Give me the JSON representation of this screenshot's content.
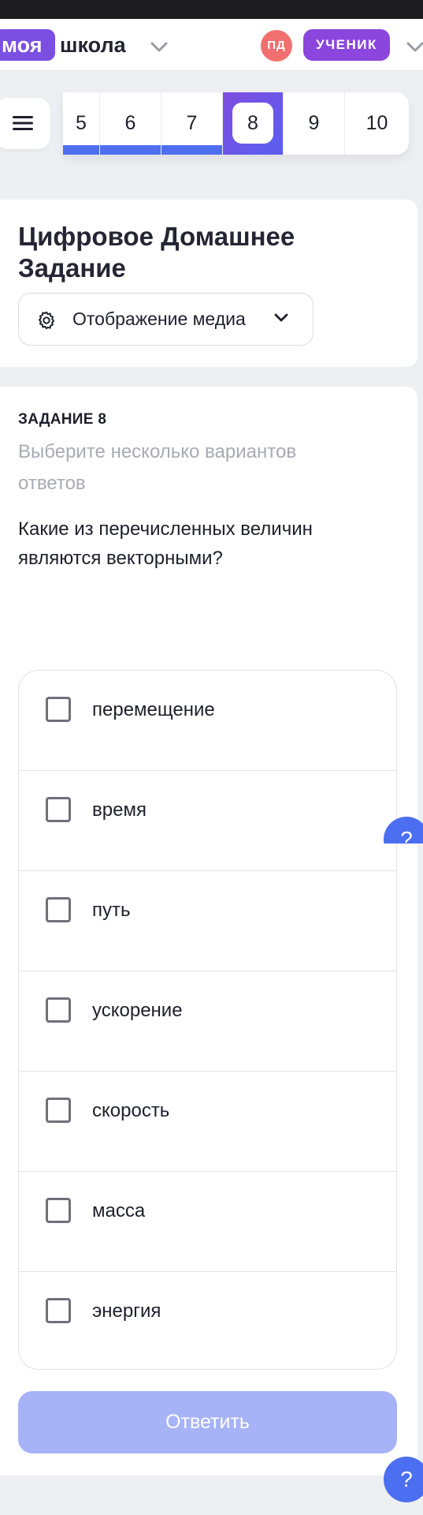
{
  "header": {
    "logo_moya": "моя",
    "logo_shkola": "школа",
    "avatar_initials": "ПД",
    "role_badge": "УЧЕНИК"
  },
  "tabs": [
    {
      "label": "5",
      "state": "done"
    },
    {
      "label": "6",
      "state": "done"
    },
    {
      "label": "7",
      "state": "done"
    },
    {
      "label": "8",
      "state": "active"
    },
    {
      "label": "9",
      "state": "pending"
    },
    {
      "label": "10",
      "state": "pending"
    }
  ],
  "title_card": {
    "title": "Цифровое Домашнее Задание",
    "media_button_label": "Отображение медиа",
    "media_button_icon": "gear-icon"
  },
  "task": {
    "number_label": "ЗАДАНИЕ 8",
    "hint": "Выберите несколько вариантов ответов",
    "question": "Какие из перечисленных величин являются векторными?",
    "options": [
      {
        "label": "перемещение",
        "checked": false
      },
      {
        "label": "время",
        "checked": false
      },
      {
        "label": "путь",
        "checked": false
      },
      {
        "label": "ускорение",
        "checked": false
      },
      {
        "label": "скорость",
        "checked": false
      },
      {
        "label": "масса",
        "checked": false
      },
      {
        "label": "энергия",
        "checked": false
      }
    ],
    "submit_label": "Ответить"
  },
  "help": {
    "icon_glyph": "?"
  },
  "colors": {
    "brand_purple": "#7a4fe2",
    "role_badge": "#8b46dd",
    "avatar": "#f26f6f",
    "progress_blue": "#4f6ff0",
    "submit_disabled": "#a7b3f7",
    "help_blue": "#4c6ef0"
  }
}
